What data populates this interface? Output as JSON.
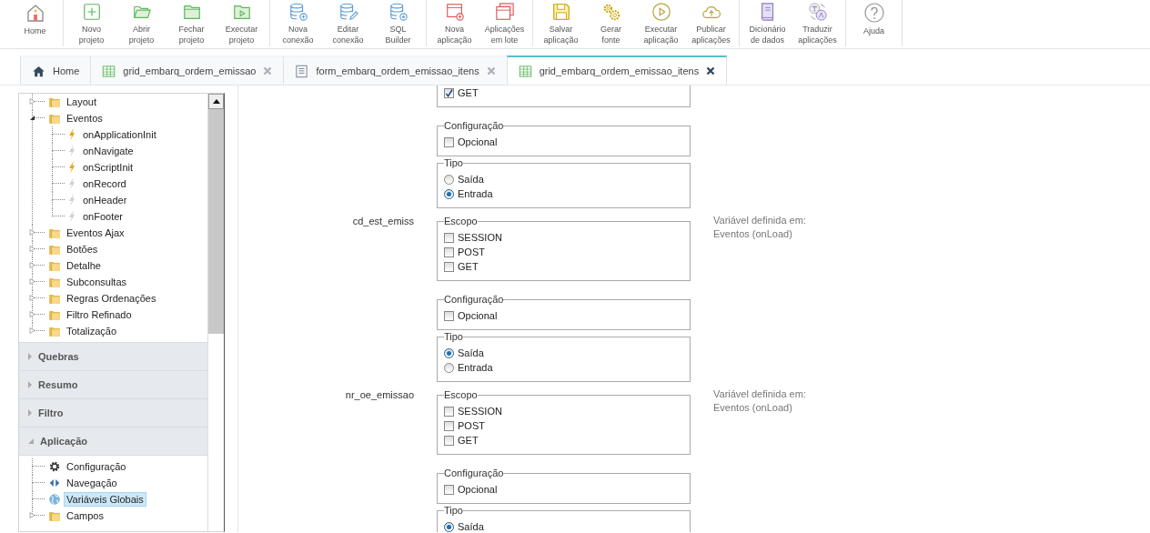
{
  "toolbar": {
    "groups": [
      [
        {
          "lines": [
            "Home"
          ]
        }
      ],
      [
        {
          "lines": [
            "Novo",
            "projeto"
          ]
        },
        {
          "lines": [
            "Abrir",
            "projeto"
          ]
        },
        {
          "lines": [
            "Fechar",
            "projeto"
          ]
        },
        {
          "lines": [
            "Executar",
            "projeto"
          ]
        }
      ],
      [
        {
          "lines": [
            "Nova",
            "conexão"
          ]
        },
        {
          "lines": [
            "Editar",
            "conexão"
          ]
        },
        {
          "lines": [
            "SQL",
            "Builder"
          ]
        }
      ],
      [
        {
          "lines": [
            "Nova",
            "aplicação"
          ]
        },
        {
          "lines": [
            "Aplicações",
            "em lote"
          ]
        }
      ],
      [
        {
          "lines": [
            "Salvar",
            "aplicação"
          ]
        },
        {
          "lines": [
            "Gerar",
            "fonte"
          ]
        },
        {
          "lines": [
            "Executar",
            "aplicação"
          ]
        },
        {
          "lines": [
            "Publicar",
            "aplicações"
          ]
        }
      ],
      [
        {
          "lines": [
            "Dicionário",
            "de dados"
          ]
        },
        {
          "lines": [
            "Traduzir",
            "aplicações"
          ]
        }
      ],
      [
        {
          "lines": [
            "Ajuda"
          ]
        }
      ]
    ]
  },
  "tabs": [
    {
      "label": "Home",
      "kind": "home",
      "closable": false,
      "selected": false
    },
    {
      "label": "grid_embarq_ordem_emissao",
      "kind": "grid",
      "closable": true,
      "selected": false
    },
    {
      "label": "form_embarq_ordem_emissao_itens",
      "kind": "form",
      "closable": true,
      "selected": false
    },
    {
      "label": "grid_embarq_ordem_emissao_itens",
      "kind": "grid",
      "closable": true,
      "selected": true
    }
  ],
  "sidebar": {
    "tree": [
      {
        "label": "Layout",
        "kind": "folder",
        "expanded": false
      },
      {
        "label": "Eventos",
        "kind": "folder",
        "expanded": true,
        "children": [
          {
            "label": "onApplicationInit",
            "kind": "event",
            "active": true
          },
          {
            "label": "onNavigate",
            "kind": "event",
            "active": false
          },
          {
            "label": "onScriptInit",
            "kind": "event",
            "active": true
          },
          {
            "label": "onRecord",
            "kind": "event",
            "active": false
          },
          {
            "label": "onHeader",
            "kind": "event",
            "active": false
          },
          {
            "label": "onFooter",
            "kind": "event",
            "active": false
          }
        ]
      },
      {
        "label": "Eventos Ajax",
        "kind": "folder",
        "expanded": false
      },
      {
        "label": "Botões",
        "kind": "folder",
        "expanded": false
      },
      {
        "label": "Detalhe",
        "kind": "folder",
        "expanded": false
      },
      {
        "label": "Subconsultas",
        "kind": "folder",
        "expanded": false
      },
      {
        "label": "Regras Ordenações",
        "kind": "folder",
        "expanded": false
      },
      {
        "label": "Filtro Refinado",
        "kind": "folder",
        "expanded": false
      },
      {
        "label": "Totalização",
        "kind": "folder",
        "expanded": false
      }
    ],
    "sections": [
      {
        "title": "Quebras",
        "expanded": false
      },
      {
        "title": "Resumo",
        "expanded": false
      },
      {
        "title": "Filtro",
        "expanded": false
      },
      {
        "title": "Aplicação",
        "expanded": true,
        "items": [
          {
            "label": "Configuração",
            "kind": "gear",
            "selected": false
          },
          {
            "label": "Navegação",
            "kind": "arrows",
            "selected": false
          },
          {
            "label": "Variáveis Globais",
            "kind": "globe",
            "selected": true
          },
          {
            "label": "Campos",
            "kind": "folder",
            "expanded": false,
            "selected": false
          }
        ]
      }
    ]
  },
  "variables": [
    {
      "groups": [
        {
          "kind": "checkbox",
          "options": [
            {
              "label": "GET",
              "checked": true
            }
          ]
        },
        {
          "kind": "checkbox",
          "legend": "Configuração",
          "options": [
            {
              "label": "Opcional",
              "checked": false
            }
          ]
        },
        {
          "kind": "radio",
          "legend": "Tipo",
          "options": [
            {
              "label": "Saída",
              "selected": false
            },
            {
              "label": "Entrada",
              "selected": true
            }
          ]
        }
      ]
    },
    {
      "name": "cd_est_emiss",
      "hint": "Variável definida em: Eventos (onLoad)",
      "groups": [
        {
          "kind": "checkbox",
          "legend": "Escopo",
          "options": [
            {
              "label": "SESSION",
              "checked": false
            },
            {
              "label": "POST",
              "checked": false
            },
            {
              "label": "GET",
              "checked": false
            }
          ]
        },
        {
          "kind": "checkbox",
          "legend": "Configuração",
          "options": [
            {
              "label": "Opcional",
              "checked": false
            }
          ]
        },
        {
          "kind": "radio",
          "legend": "Tipo",
          "options": [
            {
              "label": "Saída",
              "selected": true
            },
            {
              "label": "Entrada",
              "selected": false
            }
          ]
        }
      ]
    },
    {
      "name": "nr_oe_emissao",
      "hint": "Variável definida em: Eventos (onLoad)",
      "groups": [
        {
          "kind": "checkbox",
          "legend": "Escopo",
          "options": [
            {
              "label": "SESSION",
              "checked": false
            },
            {
              "label": "POST",
              "checked": false
            },
            {
              "label": "GET",
              "checked": false
            }
          ]
        },
        {
          "kind": "checkbox",
          "legend": "Configuração",
          "options": [
            {
              "label": "Opcional",
              "checked": false
            }
          ]
        },
        {
          "kind": "radio",
          "legend": "Tipo",
          "options": [
            {
              "label": "Saída",
              "selected": true
            }
          ]
        }
      ]
    }
  ]
}
